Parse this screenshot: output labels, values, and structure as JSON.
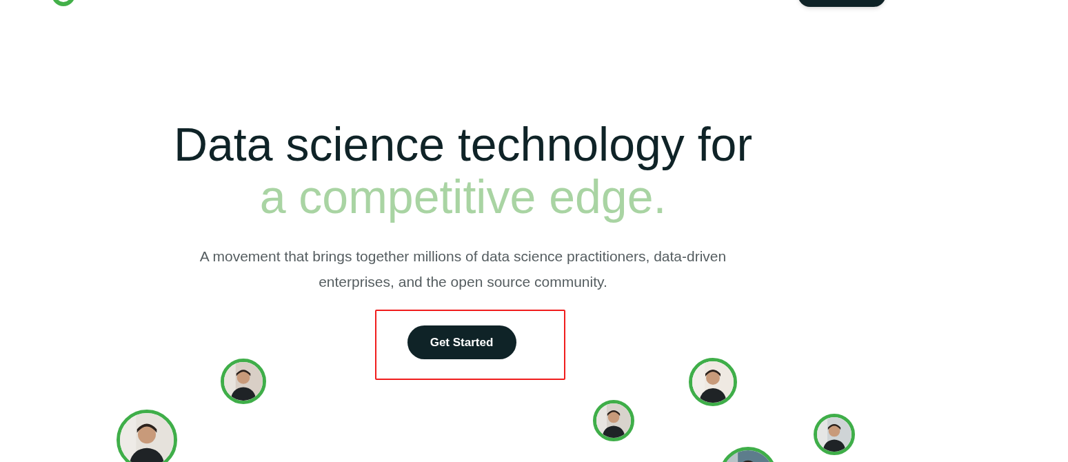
{
  "hero": {
    "headline": "Data science technology for",
    "headline_accent": "a competitive edge.",
    "description": "A movement that brings together millions of data science practitioners, data-driven enterprises, and the open source community.",
    "cta": "Get Started"
  }
}
